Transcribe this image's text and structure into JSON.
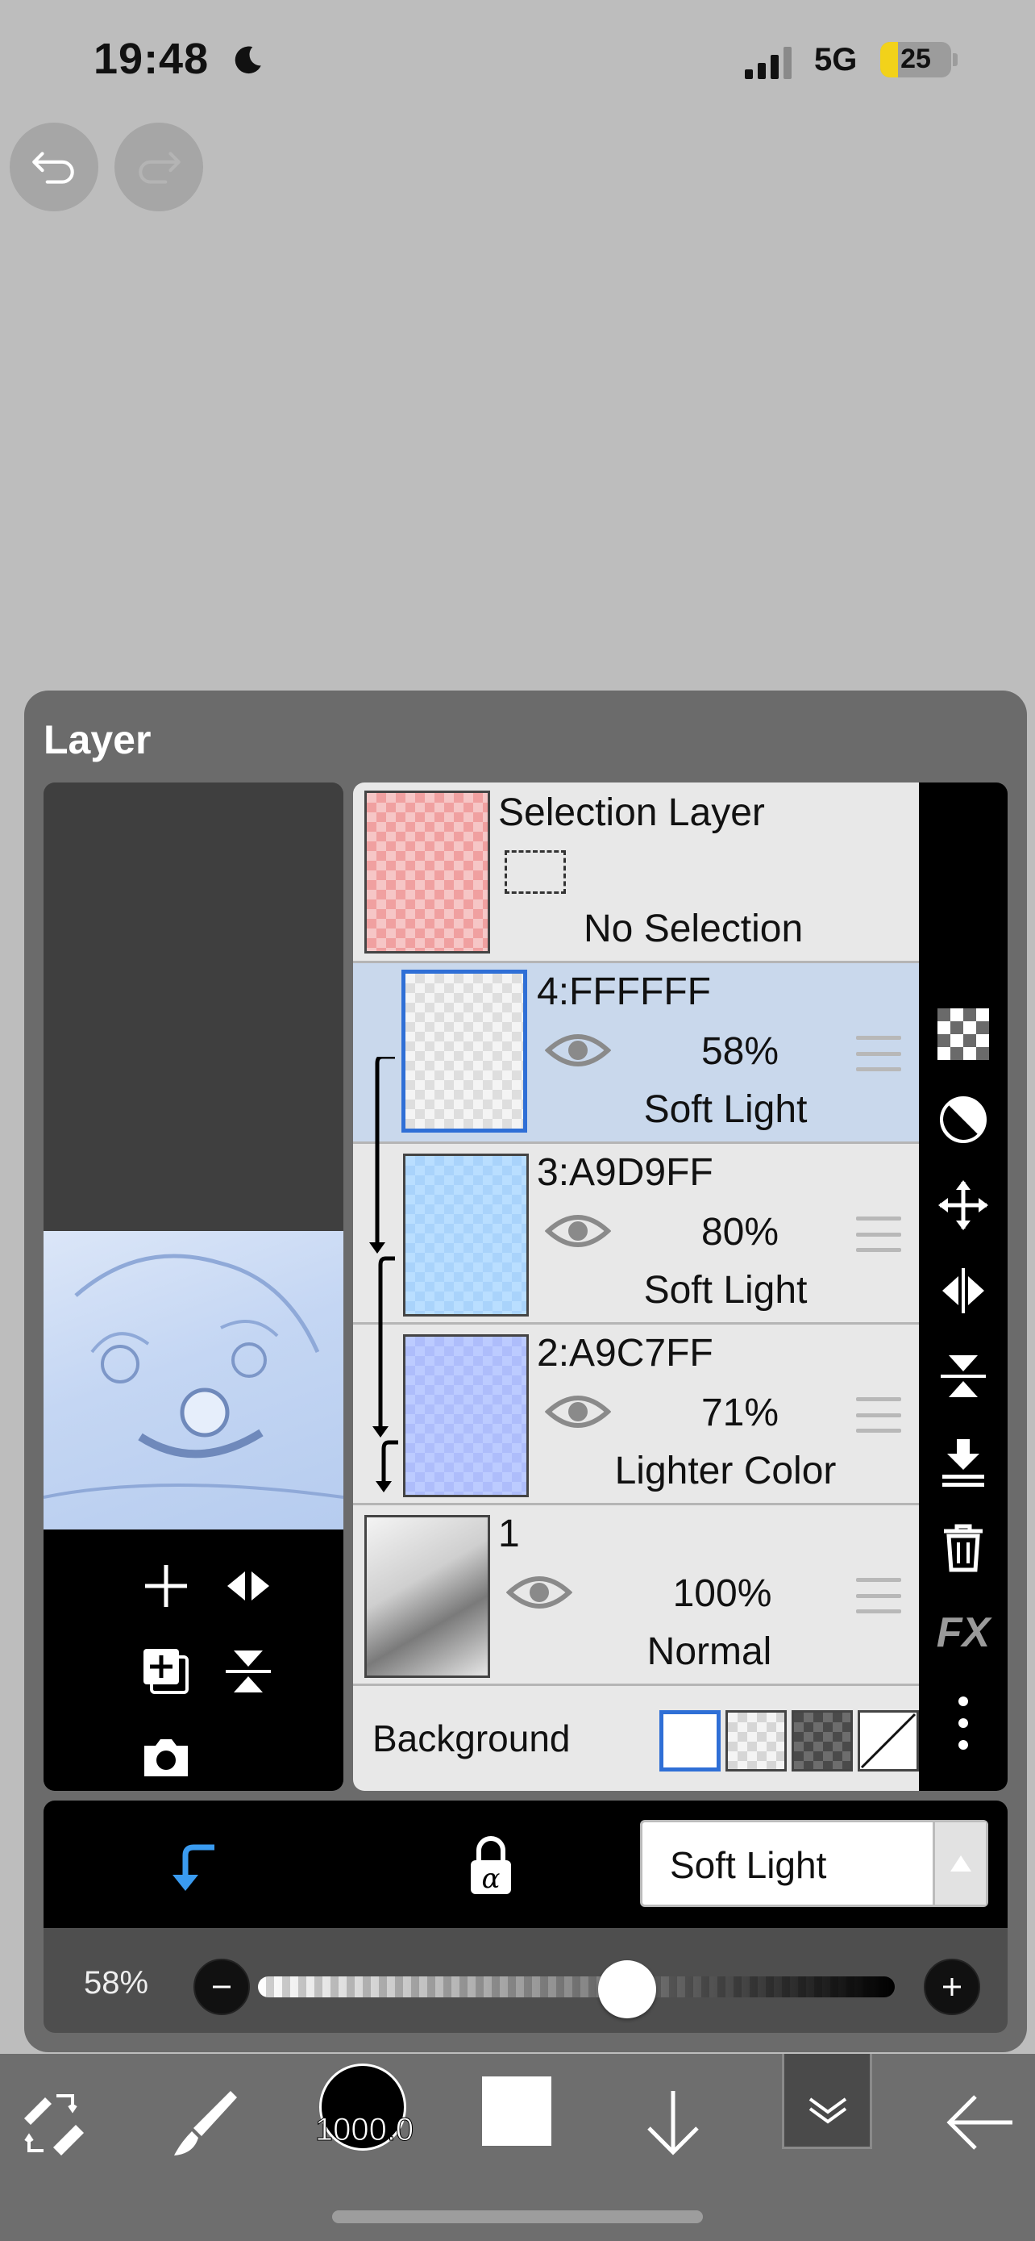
{
  "status_bar": {
    "time": "19:48",
    "network": "5G",
    "battery": "25"
  },
  "panel": {
    "title": "Layer"
  },
  "selection_layer": {
    "name": "Selection Layer",
    "status": "No Selection"
  },
  "layers": [
    {
      "name": "4:FFFFFF",
      "opacity": "58%",
      "blend": "Soft Light"
    },
    {
      "name": "3:A9D9FF",
      "opacity": "80%",
      "blend": "Soft Light"
    },
    {
      "name": "2:A9C7FF",
      "opacity": "71%",
      "blend": "Lighter Color"
    },
    {
      "name": "1",
      "opacity": "100%",
      "blend": "Normal"
    }
  ],
  "background": {
    "label": "Background"
  },
  "side_tools": {
    "fx_label": "FX"
  },
  "blend_select": {
    "value": "Soft Light"
  },
  "opacity_slider": {
    "label": "58%",
    "value": 0.58
  },
  "toolbar": {
    "brush_size": "1000.0"
  },
  "colors": {
    "accent": "#2f6fd6",
    "clip_arrow": "#3a9bf0",
    "selected_row": "#c9d8ec"
  }
}
